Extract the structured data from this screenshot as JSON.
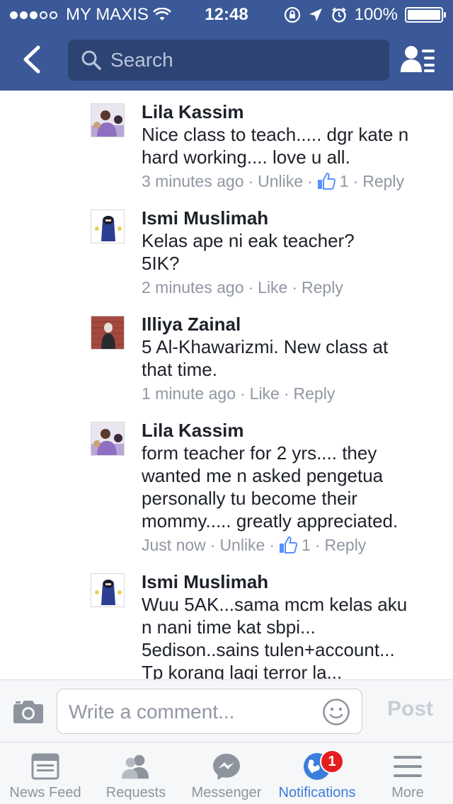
{
  "status_bar": {
    "carrier": "MY MAXIS",
    "time": "12:48",
    "battery": "100%",
    "signal_bars_filled": 3,
    "signal_bars_total": 5
  },
  "search": {
    "placeholder": "Search"
  },
  "comments": [
    {
      "name": "Lila Kassim",
      "lines": [
        "Nice class to teach..... dgr kate n",
        "hard working.... love u all."
      ],
      "time": "3 minutes ago",
      "action": "Unlike",
      "likes": "1",
      "reply": "Reply"
    },
    {
      "name": "Ismi Muslimah",
      "lines": [
        "Kelas ape ni eak teacher?",
        "5IK?"
      ],
      "time": "2 minutes ago",
      "action": "Like",
      "reply": "Reply"
    },
    {
      "name": "Illiya Zainal",
      "lines": [
        "5 Al-Khawarizmi. New class at",
        "that time."
      ],
      "time": "1 minute ago",
      "action": "Like",
      "reply": "Reply"
    },
    {
      "name": "Lila Kassim",
      "lines": [
        "form teacher for 2 yrs.... they",
        "wanted me n asked pengetua",
        "personally tu become their",
        "mommy..... greatly appreciated."
      ],
      "time": "Just now",
      "action": "Unlike",
      "likes": "1",
      "reply": "Reply"
    },
    {
      "name": "Ismi Muslimah",
      "lines": [
        "Wuu 5AK...sama mcm kelas aku",
        "n nani time kat sbpi...",
        "5edison..sains tulen+account...",
        "Tp korang lagi terror la..."
      ]
    }
  ],
  "composer": {
    "placeholder": "Write a comment...",
    "post_label": "Post"
  },
  "tabs": [
    {
      "label": "News Feed",
      "icon": "news-feed-icon"
    },
    {
      "label": "Requests",
      "icon": "requests-icon"
    },
    {
      "label": "Messenger",
      "icon": "messenger-icon"
    },
    {
      "label": "Notifications",
      "icon": "notifications-globe-icon",
      "badge": "1",
      "active": true
    },
    {
      "label": "More",
      "icon": "menu-icon"
    }
  ],
  "colors": {
    "header": "#3b5998",
    "active_tab": "#3b7ddd",
    "badge": "#e41e1e",
    "meta_text": "#9197a3"
  }
}
